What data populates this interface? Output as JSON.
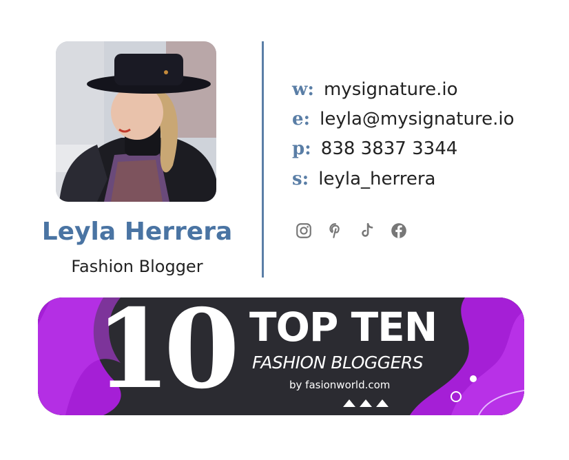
{
  "profile": {
    "name": "Leyla Herrera",
    "role": "Fashion Blogger"
  },
  "contacts": [
    {
      "key": "w:",
      "value": "mysignature.io"
    },
    {
      "key": "e:",
      "value": "leyla@mysignature.io"
    },
    {
      "key": "p:",
      "value": "838 3837 3344"
    },
    {
      "key": "s:",
      "value": "leyla_herrera"
    }
  ],
  "social": [
    "instagram-icon",
    "pinterest-icon",
    "tiktok-icon",
    "facebook-icon"
  ],
  "banner": {
    "number": "10",
    "title": "TOP TEN",
    "subtitle": "FASHION BLOGGERS",
    "byline": "by fasionworld.com"
  },
  "colors": {
    "accent": "#4a74a3",
    "divider": "#5a7ea6",
    "banner_dark": "#2b2b31",
    "banner_purple": "#a51fd6",
    "icon_gray": "#777777"
  }
}
